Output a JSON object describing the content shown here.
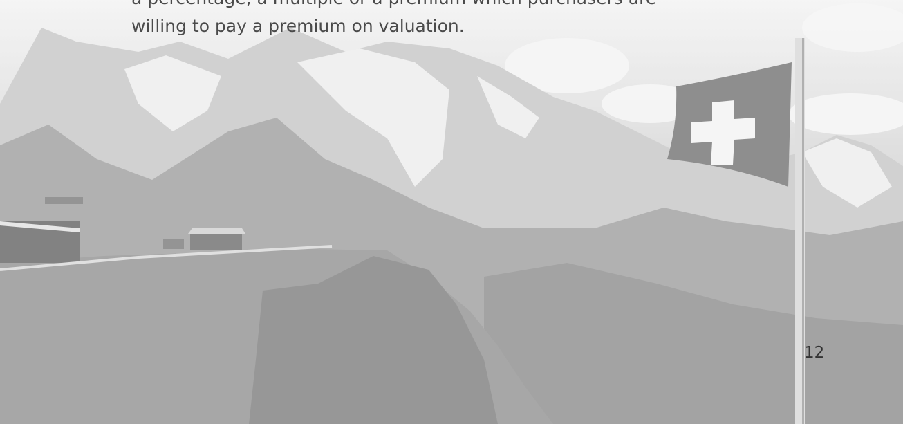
{
  "body": {
    "line_1": "a percentage, a multiple or a premium which purchasers are",
    "line_2": "willing to pay a premium on valuation."
  },
  "page_number": "12",
  "colors": {
    "text": "#4a4a4a",
    "flag_field": "#6f6f6f",
    "flag_cross": "#f2f2f2"
  },
  "icons": {
    "background": "swiss-alps-photo",
    "flag": "swiss-flag-icon"
  }
}
